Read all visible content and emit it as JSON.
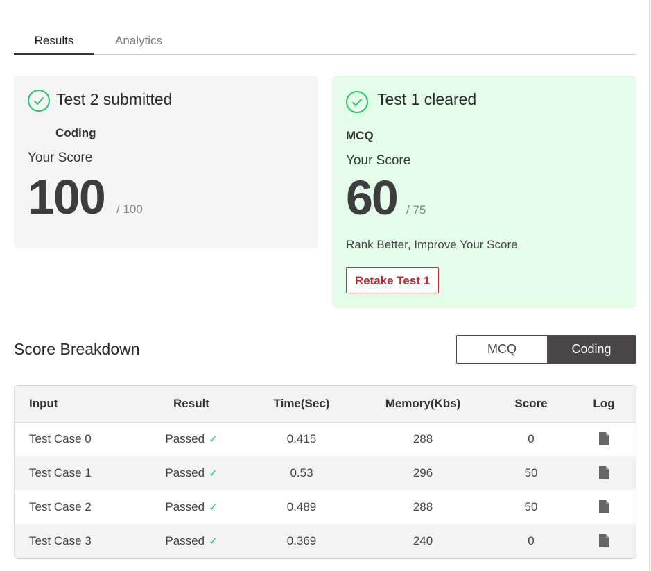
{
  "tabs": [
    {
      "label": "Results",
      "active": true
    },
    {
      "label": "Analytics",
      "active": false
    }
  ],
  "card_left": {
    "title": "Test 2 submitted",
    "subtitle": "Coding",
    "score_label": "Your Score",
    "score": "100",
    "max": "/ 100"
  },
  "card_right": {
    "title": "Test 1 cleared",
    "subtitle": "MCQ",
    "score_label": "Your Score",
    "score": "60",
    "max": "/ 75",
    "rank_text": "Rank Better, Improve Your Score",
    "retake_label": "Retake Test 1"
  },
  "breakdown": {
    "title": "Score Breakdown",
    "toggle": {
      "mcq": "MCQ",
      "coding": "Coding",
      "selected": "Coding"
    },
    "columns": [
      "Input",
      "Result",
      "Time(Sec)",
      "Memory(Kbs)",
      "Score",
      "Log"
    ],
    "rows": [
      {
        "input": "Test Case 0",
        "result": "Passed",
        "time": "0.415",
        "memory": "288",
        "score": "0"
      },
      {
        "input": "Test Case 1",
        "result": "Passed",
        "time": "0.53",
        "memory": "296",
        "score": "50"
      },
      {
        "input": "Test Case 2",
        "result": "Passed",
        "time": "0.489",
        "memory": "288",
        "score": "50"
      },
      {
        "input": "Test Case 3",
        "result": "Passed",
        "time": "0.369",
        "memory": "240",
        "score": "0"
      }
    ]
  },
  "icons": {
    "check": "check-circle-icon",
    "pass": "check-mark-icon",
    "log": "file-icon"
  },
  "colors": {
    "success": "#27c46b",
    "danger": "#c0283a",
    "toggle_active": "#4a4646",
    "cleared_bg": "#e4fde9"
  }
}
